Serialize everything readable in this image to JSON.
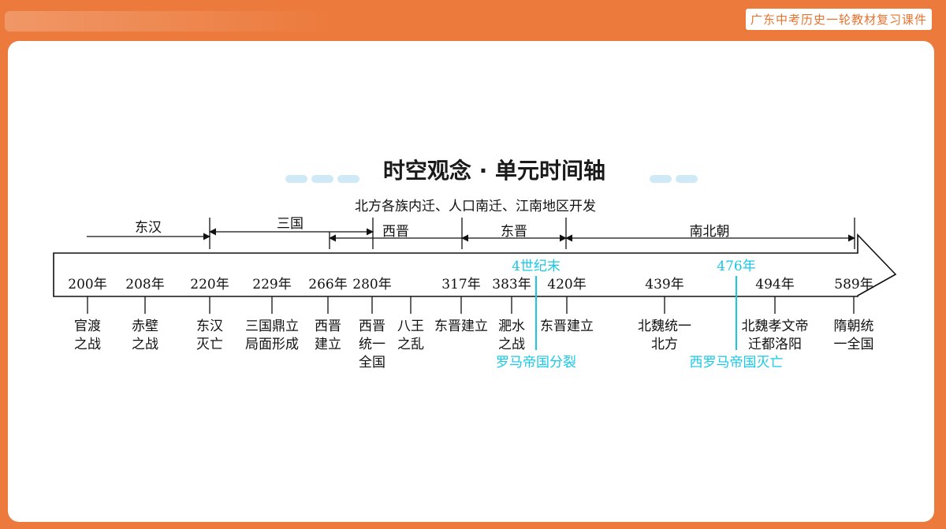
{
  "header": {
    "badge": "广东中考历史一轮教材复习课件"
  },
  "title": "时空观念 · 单元时间轴",
  "subtitle": "北方各族内迁、人口南迁、江南地区开发",
  "periods": [
    {
      "label": "东汉"
    },
    {
      "label": "三国"
    },
    {
      "label": "西晋"
    },
    {
      "label": "东晋"
    },
    {
      "label": "南北朝"
    }
  ],
  "years": [
    "200年",
    "208年",
    "220年",
    "229年",
    "266年",
    "280年",
    "317年",
    "383年",
    "420年",
    "439年",
    "494年",
    "589年"
  ],
  "events": [
    {
      "lines": [
        "官渡",
        "之战"
      ]
    },
    {
      "lines": [
        "赤壁",
        "之战"
      ]
    },
    {
      "lines": [
        "东汉",
        "灭亡"
      ]
    },
    {
      "lines": [
        "三国鼎立",
        "局面形成"
      ]
    },
    {
      "lines": [
        "西晋",
        "建立"
      ]
    },
    {
      "lines": [
        "西晋",
        "统一",
        "全国"
      ]
    },
    {
      "lines": [
        "八王",
        "之乱"
      ]
    },
    {
      "lines": [
        "东晋建立"
      ]
    },
    {
      "lines": [
        "淝水",
        "之战"
      ]
    },
    {
      "lines": [
        "东晋建立"
      ]
    },
    {
      "lines": [
        "北魏统一",
        "北方"
      ]
    },
    {
      "lines": [
        "北魏孝文帝",
        "迁都洛阳"
      ]
    },
    {
      "lines": [
        "隋朝统",
        "一全国"
      ]
    }
  ],
  "world_events": [
    {
      "time": "4世纪末",
      "event": "罗马帝国分裂"
    },
    {
      "time": "476年",
      "event": "西罗马帝国灭亡"
    }
  ],
  "colors": {
    "frame": "#ec7a3c",
    "accent": "#19c8e6",
    "dash": "#cfe9f7"
  }
}
